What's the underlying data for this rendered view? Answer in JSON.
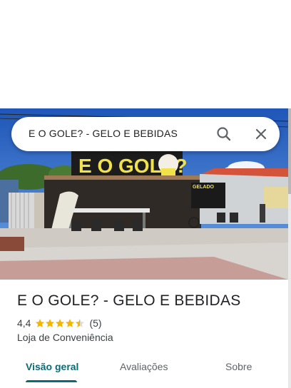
{
  "search": {
    "query": "E O GOLE? - GELO E BEBIDAS",
    "search_icon": "search-icon",
    "close_icon": "close-icon"
  },
  "photo": {
    "sign_text": "E O GOLE?",
    "side_sign_text": "GELADO"
  },
  "place": {
    "name": "E O GOLE? - GELO E BEBIDAS",
    "rating": "4,4",
    "stars": 4.4,
    "review_count": "(5)",
    "category": "Loja de Conveniência"
  },
  "tabs": [
    {
      "label": "Visão geral",
      "active": true
    },
    {
      "label": "Avaliações",
      "active": false
    },
    {
      "label": "Sobre",
      "active": false
    }
  ],
  "colors": {
    "accent": "#0b6b74",
    "star": "#f4b400",
    "star_empty": "#dadce0"
  }
}
